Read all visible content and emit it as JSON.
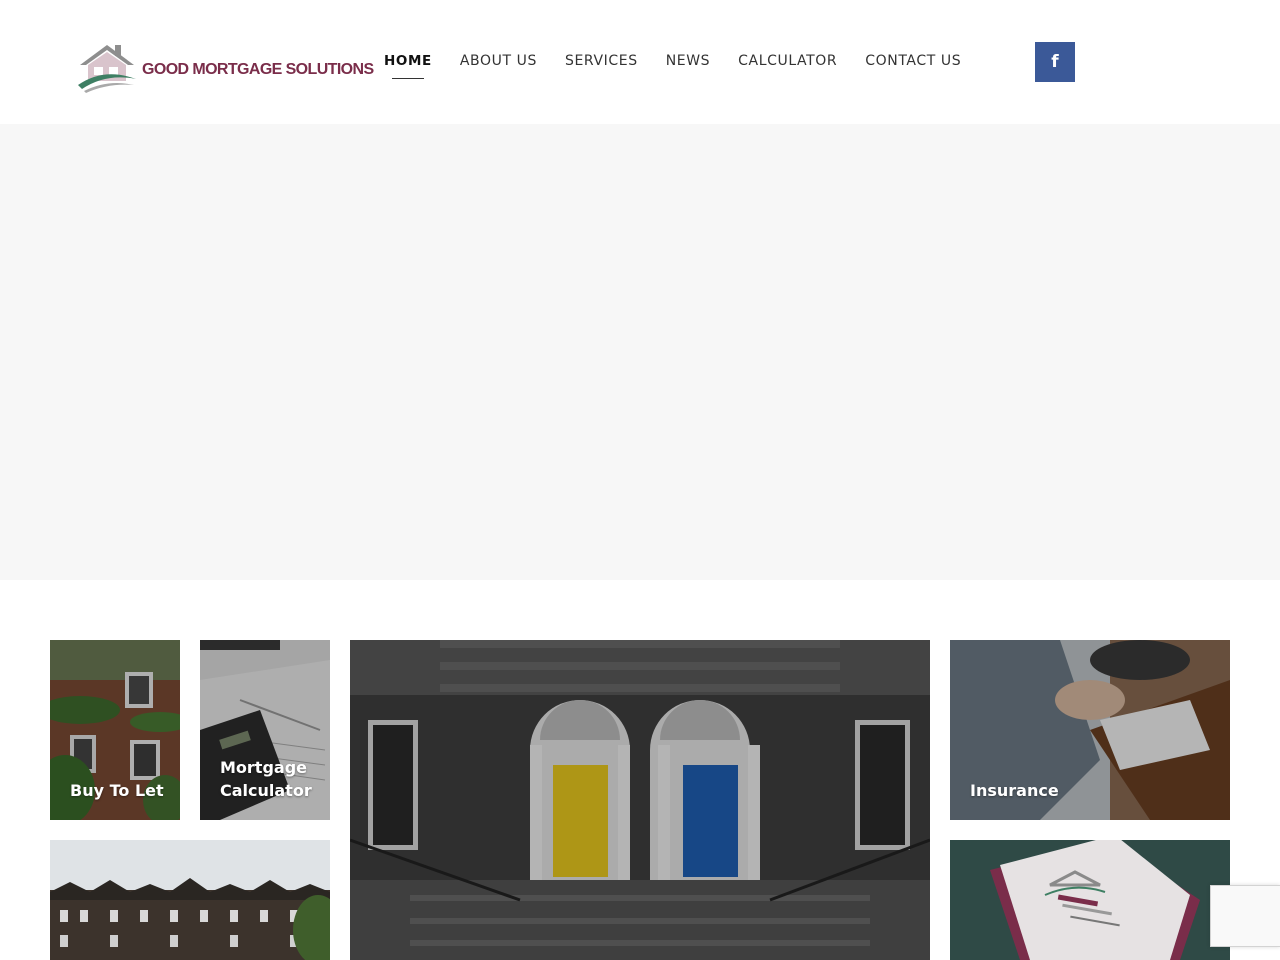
{
  "logo": {
    "text": "GOOD MORTGAGE SOLUTIONS",
    "icon": "house-logo-icon"
  },
  "nav": {
    "items": [
      {
        "label": "HOME",
        "active": true
      },
      {
        "label": "ABOUT US"
      },
      {
        "label": "SERVICES"
      },
      {
        "label": "NEWS"
      },
      {
        "label": "CALCULATOR"
      },
      {
        "label": "CONTACT US"
      }
    ]
  },
  "social": {
    "facebook_glyph": "f",
    "icon": "facebook-icon"
  },
  "tiles": {
    "buy_to_let": "Buy To Let",
    "mortgage_calculator_line1": "Mortgage",
    "mortgage_calculator_line2": "Calculator",
    "insurance": "Insurance"
  },
  "colors": {
    "brand": "#7a2d4a",
    "facebook": "#3b5998",
    "hero_bg": "#f7f7f7"
  }
}
